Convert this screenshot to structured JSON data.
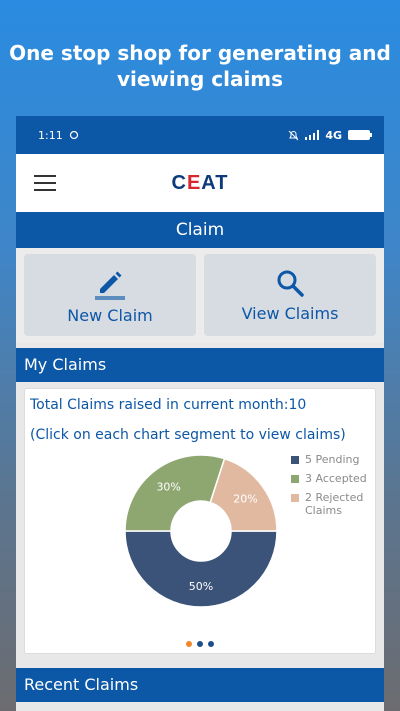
{
  "promo": {
    "line1": "One stop shop for generating and",
    "line2": "viewing claims"
  },
  "status": {
    "time": "1:11",
    "network": "4G"
  },
  "appbar": {
    "logo_prefix": "C",
    "logo_accent": "E",
    "logo_suffix": "AT"
  },
  "claim_header": "Claim",
  "actions": {
    "new_claim": "New Claim",
    "view_claims": "View Claims"
  },
  "my_claims": {
    "title": "My Claims",
    "total_text": "Total Claims raised in current month:10",
    "hint": "(Click on each chart segment to view claims)"
  },
  "chart_data": {
    "type": "pie",
    "categories": [
      "Pending",
      "Accepted",
      "Rejected Claims"
    ],
    "values": [
      5,
      3,
      2
    ],
    "percent_labels": [
      "50%",
      "30%",
      "20%"
    ],
    "legend": [
      "5 Pending",
      "3 Accepted",
      "2 Rejected Claims"
    ],
    "colors": [
      "#3b5378",
      "#8ea771",
      "#e1b9a1"
    ],
    "donut": true,
    "legend_position": "right"
  },
  "recent_claims": {
    "title": "Recent Claims"
  },
  "colors": {
    "primary": "#0c57a6",
    "accent": "#d8272e"
  }
}
